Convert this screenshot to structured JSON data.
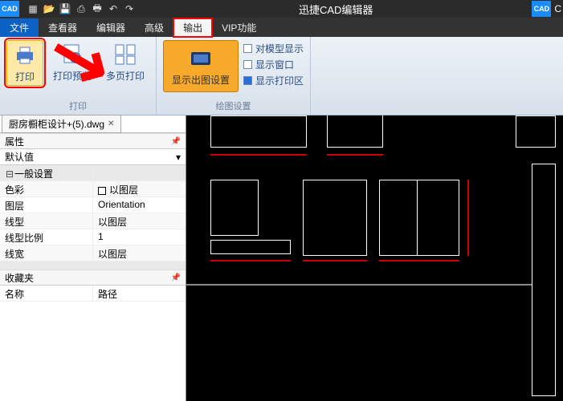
{
  "app": {
    "title": "迅捷CAD编辑器",
    "logo_left": "CAD",
    "logo_right": "C"
  },
  "toolbar_icons": [
    "new",
    "open",
    "save",
    "saveas",
    "print-small",
    "undo",
    "redo"
  ],
  "menu": {
    "file": "文件",
    "viewer": "查看器",
    "editor": "编辑器",
    "advanced": "高级",
    "output": "输出",
    "vip": "VIP功能"
  },
  "ribbon": {
    "print_group": {
      "title": "打印",
      "print": "打印",
      "preview": "打印预览",
      "multipage": "多页打印"
    },
    "draw_group": {
      "title": "绘图设置",
      "show_drawing": "显示出图设置",
      "opt_model": "对模型显示",
      "opt_window": "显示窗口",
      "opt_printarea": "显示打印区"
    }
  },
  "tab": {
    "name": "厨房橱柜设计+(5).dwg"
  },
  "props": {
    "title": "属性",
    "default": "默认值",
    "general": "一般设置",
    "rows": [
      {
        "k": "色彩",
        "v": "以图层",
        "sq": true
      },
      {
        "k": "图层",
        "v": "Orientation"
      },
      {
        "k": "线型",
        "v": "以图层"
      },
      {
        "k": "线型比例",
        "v": "1"
      },
      {
        "k": "线宽",
        "v": "以图层"
      }
    ]
  },
  "fav": {
    "title": "收藏夹",
    "col1": "名称",
    "col2": "路径"
  }
}
